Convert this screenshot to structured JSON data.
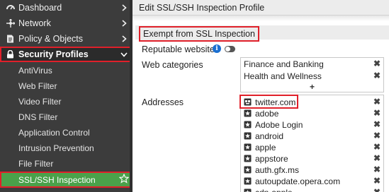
{
  "sidebar": {
    "items": [
      {
        "label": "Dashboard",
        "icon": "dashboard-icon"
      },
      {
        "label": "Network",
        "icon": "network-icon"
      },
      {
        "label": "Policy & Objects",
        "icon": "policy-icon"
      },
      {
        "label": "Security Profiles",
        "icon": "lock-icon"
      }
    ],
    "sub_items": [
      "AntiVirus",
      "Web Filter",
      "Video Filter",
      "DNS Filter",
      "Application Control",
      "Intrusion Prevention",
      "File Filter",
      "SSL/SSH Inspection"
    ]
  },
  "header": {
    "title": "Edit SSL/SSH Inspection Profile"
  },
  "section": {
    "title": "Exempt from SSL Inspection"
  },
  "fields": {
    "reputable_label": "Reputable websites",
    "reputable_enabled": false,
    "web_categories_label": "Web categories",
    "addresses_label": "Addresses"
  },
  "web_categories": [
    "Finance and Banking",
    "Health and Wellness"
  ],
  "add_symbol": "+",
  "remove_symbol": "✖",
  "addresses": [
    "twitter.com",
    "adobe",
    "Adobe Login",
    "android",
    "apple",
    "appstore",
    "auth.gfx.ms",
    "autoupdate.opera.com",
    "cdn-apple"
  ],
  "colors": {
    "sidebar_bg": "#3c3c3c",
    "active_green": "#4aa14a",
    "highlight_red": "#e0202a",
    "info_blue": "#1b6fd0"
  }
}
